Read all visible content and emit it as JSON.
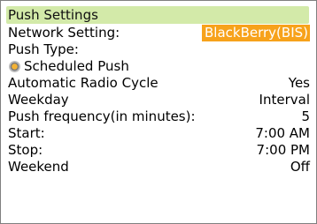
{
  "screen": {
    "title": "Push Settings"
  },
  "settings": {
    "network_label": "Network Setting:",
    "network_value": "BlackBerry(BIS)",
    "push_type_label": "Push Type:",
    "push_type_option": "Scheduled Push",
    "auto_radio_label": "Automatic Radio Cycle",
    "auto_radio_value": "Yes",
    "weekday_label": "Weekday",
    "weekday_value": "Interval",
    "push_freq_label": "Push frequency(in minutes):",
    "push_freq_value": "5",
    "start_label": "Start:",
    "start_value": "7:00 AM",
    "stop_label": "Stop:",
    "stop_value": "7:00 PM",
    "weekend_label": "Weekend",
    "weekend_value": "Off"
  },
  "colors": {
    "header_bg": "#d3eaa9",
    "selected_value_bg": "#f7a21b"
  },
  "icons": {
    "push_type_radio": "radio-selected-icon"
  }
}
